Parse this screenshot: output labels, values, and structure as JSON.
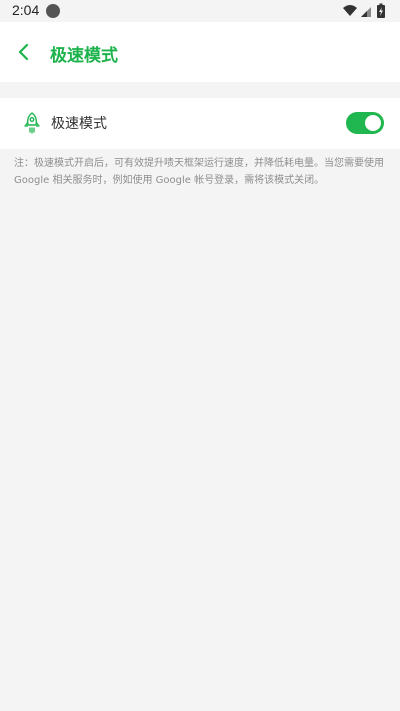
{
  "statusbar": {
    "time": "2:04"
  },
  "appbar": {
    "title": "极速模式"
  },
  "settings": {
    "turbo_label": "极速模式",
    "turbo_enabled": true
  },
  "note": {
    "text": "注：极速模式开启后，可有效提升啧天框架运行速度，并降低耗电量。当您需要使用 Google 相关服务时，例如使用 Google 帐号登录，需将该模式关闭。"
  },
  "colors": {
    "accent": "#1db34c",
    "toggle_on": "#20b650",
    "background": "#f4f4f4"
  }
}
